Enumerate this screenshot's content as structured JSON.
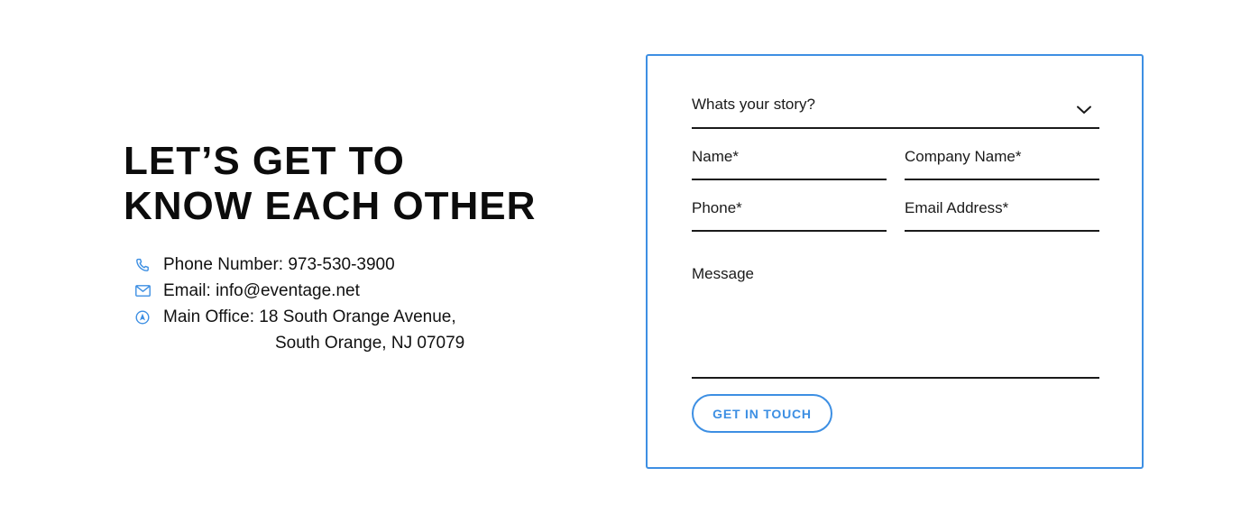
{
  "heading": {
    "line1": "LET’S GET TO",
    "line2": "KNOW EACH OTHER"
  },
  "contact": {
    "phone": {
      "icon": "phone-icon",
      "text": "Phone Number: 973-530-3900"
    },
    "email": {
      "icon": "mail-icon",
      "text": "Email: info@eventage.net"
    },
    "office": {
      "icon": "location-icon",
      "line1": "Main Office: 18 South Orange Avenue,",
      "line2": "South Orange, NJ 07079"
    }
  },
  "form": {
    "story_select": {
      "placeholder": "Whats your story?",
      "icon": "chevron-down-icon"
    },
    "name_field": "Name*",
    "company_field": "Company Name*",
    "phone_field": "Phone*",
    "email_field": "Email Address*",
    "message_field": "Message",
    "submit_label": "GET IN TOUCH"
  },
  "colors": {
    "accent": "#3d8fe3",
    "text": "#111111",
    "underline": "#1a1a1a",
    "background": "#ffffff"
  }
}
